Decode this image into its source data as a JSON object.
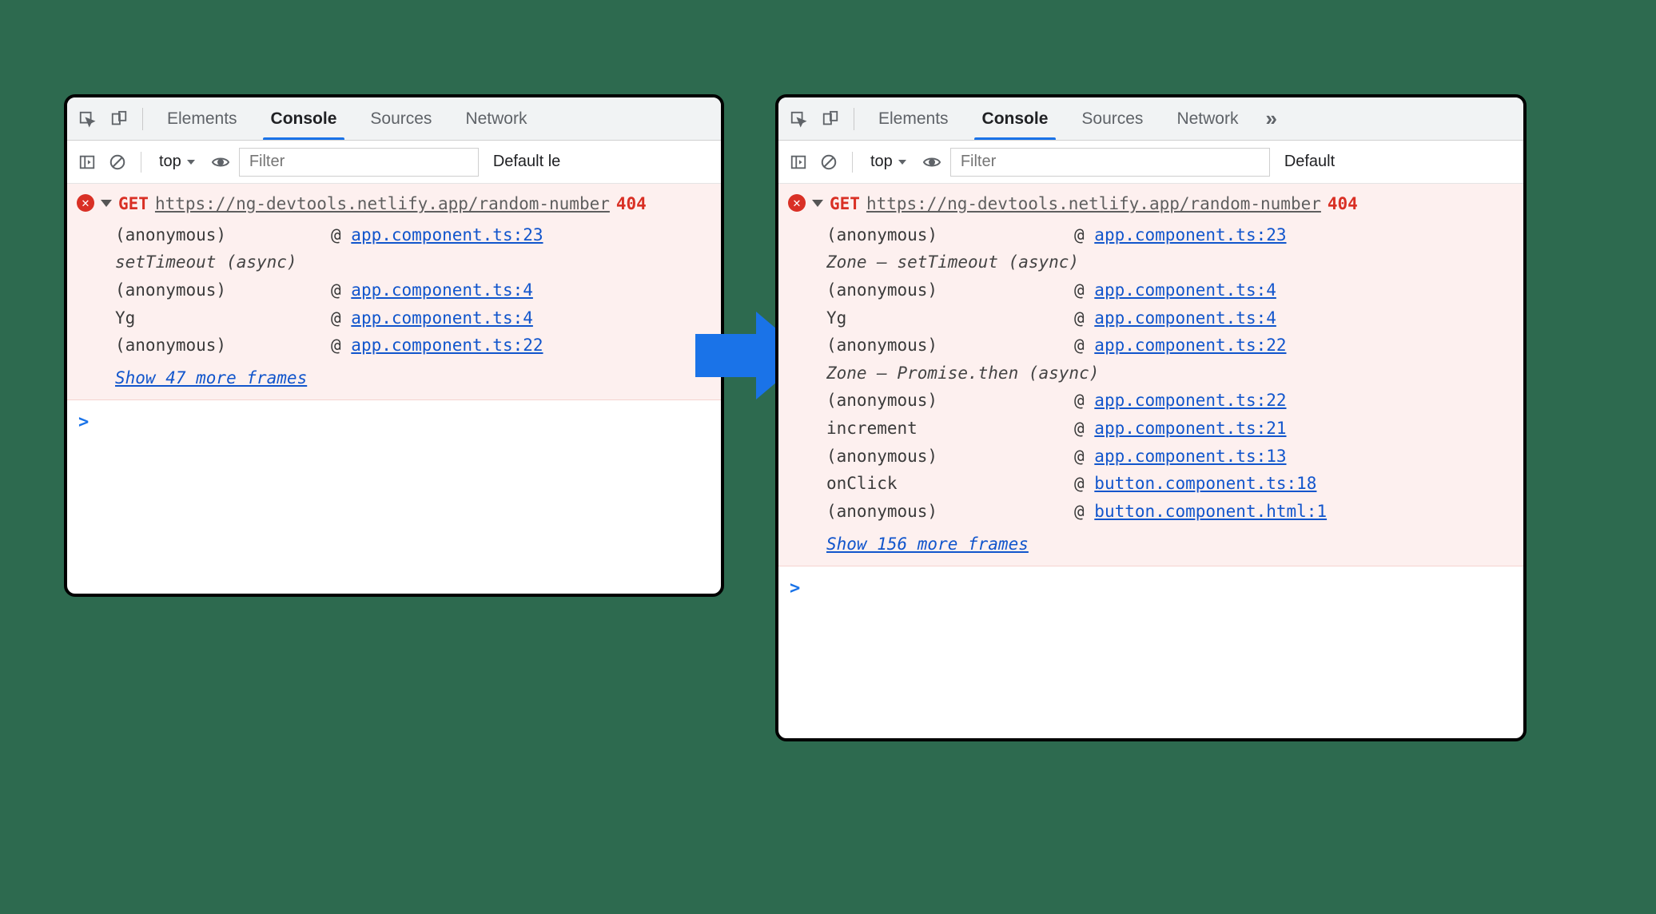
{
  "tabs": {
    "elements": "Elements",
    "console": "Console",
    "sources": "Sources",
    "network": "Network",
    "more": "»"
  },
  "toolbar": {
    "context": "top",
    "filter_placeholder": "Filter",
    "levels_left": "Default le",
    "levels_right": "Default"
  },
  "left": {
    "method": "GET",
    "url": "https://ng-devtools.netlify.app/random-number",
    "status": "404",
    "stack": [
      {
        "fn": "(anonymous)",
        "at": "@",
        "link": "app.component.ts:23"
      },
      {
        "async": "setTimeout (async)"
      },
      {
        "fn": "(anonymous)",
        "at": "@",
        "link": "app.component.ts:4"
      },
      {
        "fn": "Yg",
        "at": "@",
        "link": "app.component.ts:4"
      },
      {
        "fn": "(anonymous)",
        "at": "@",
        "link": "app.component.ts:22"
      }
    ],
    "more": "Show 47 more frames"
  },
  "right": {
    "method": "GET",
    "url": "https://ng-devtools.netlify.app/random-number",
    "status": "404",
    "stack": [
      {
        "fn": "(anonymous)",
        "at": "@",
        "link": "app.component.ts:23"
      },
      {
        "async": "Zone — setTimeout (async)"
      },
      {
        "fn": "(anonymous)",
        "at": "@",
        "link": "app.component.ts:4"
      },
      {
        "fn": "Yg",
        "at": "@",
        "link": "app.component.ts:4"
      },
      {
        "fn": "(anonymous)",
        "at": "@",
        "link": "app.component.ts:22"
      },
      {
        "async": "Zone — Promise.then (async)"
      },
      {
        "fn": "(anonymous)",
        "at": "@",
        "link": "app.component.ts:22"
      },
      {
        "fn": "increment",
        "at": "@",
        "link": "app.component.ts:21"
      },
      {
        "fn": "(anonymous)",
        "at": "@",
        "link": "app.component.ts:13"
      },
      {
        "fn": "onClick",
        "at": "@",
        "link": "button.component.ts:18"
      },
      {
        "fn": "(anonymous)",
        "at": "@",
        "link": "button.component.html:1"
      }
    ],
    "more": "Show 156 more frames"
  },
  "prompt": ">"
}
